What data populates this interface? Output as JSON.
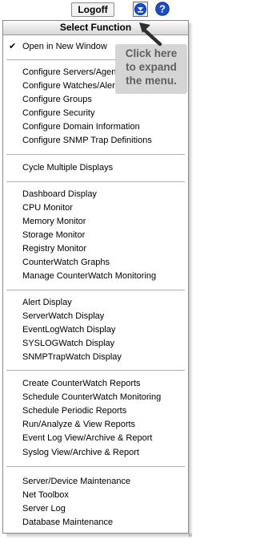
{
  "toolbar": {
    "logoff_label": "Logoff",
    "menu_icon": "down-arrow-menu-icon",
    "help_icon": "help-icon",
    "help_glyph": "?",
    "accent_color": "#1a4fc8"
  },
  "menu": {
    "title": "Select Function",
    "check_glyph": "✔",
    "groups": [
      {
        "items": [
          {
            "label": "Open in New Window",
            "checked": true
          }
        ]
      },
      {
        "items": [
          {
            "label": "Configure Servers/Agents"
          },
          {
            "label": "Configure Watches/Alerts"
          },
          {
            "label": "Configure Groups"
          },
          {
            "label": "Configure Security"
          },
          {
            "label": "Configure Domain Information"
          },
          {
            "label": "Configure SNMP Trap Definitions"
          }
        ]
      },
      {
        "items": [
          {
            "label": "Cycle Multiple Displays"
          }
        ]
      },
      {
        "items": [
          {
            "label": "Dashboard Display"
          },
          {
            "label": "CPU Monitor"
          },
          {
            "label": "Memory Monitor"
          },
          {
            "label": "Storage Monitor"
          },
          {
            "label": "Registry Monitor"
          },
          {
            "label": "CounterWatch Graphs"
          },
          {
            "label": "Manage CounterWatch Monitoring"
          }
        ]
      },
      {
        "items": [
          {
            "label": "Alert Display"
          },
          {
            "label": "ServerWatch Display"
          },
          {
            "label": "EventLogWatch Display"
          },
          {
            "label": "SYSLOGWatch Display"
          },
          {
            "label": "SNMPTrapWatch Display"
          }
        ]
      },
      {
        "items": [
          {
            "label": "Create CounterWatch Reports"
          },
          {
            "label": "Schedule CounterWatch Monitoring"
          },
          {
            "label": "Schedule Periodic Reports"
          },
          {
            "label": "Run/Analyze & View Reports"
          },
          {
            "label": "Event Log View/Archive & Report"
          },
          {
            "label": "Syslog View/Archive & Report"
          }
        ]
      },
      {
        "items": [
          {
            "label": "Server/Device Maintenance"
          },
          {
            "label": "Net Toolbox"
          },
          {
            "label": "Server Log"
          },
          {
            "label": "Database Maintenance"
          }
        ]
      }
    ]
  },
  "callout": {
    "lines": [
      "Click here",
      "to expand",
      "the menu."
    ],
    "arrow_icon": "pointer-arrow-icon"
  }
}
